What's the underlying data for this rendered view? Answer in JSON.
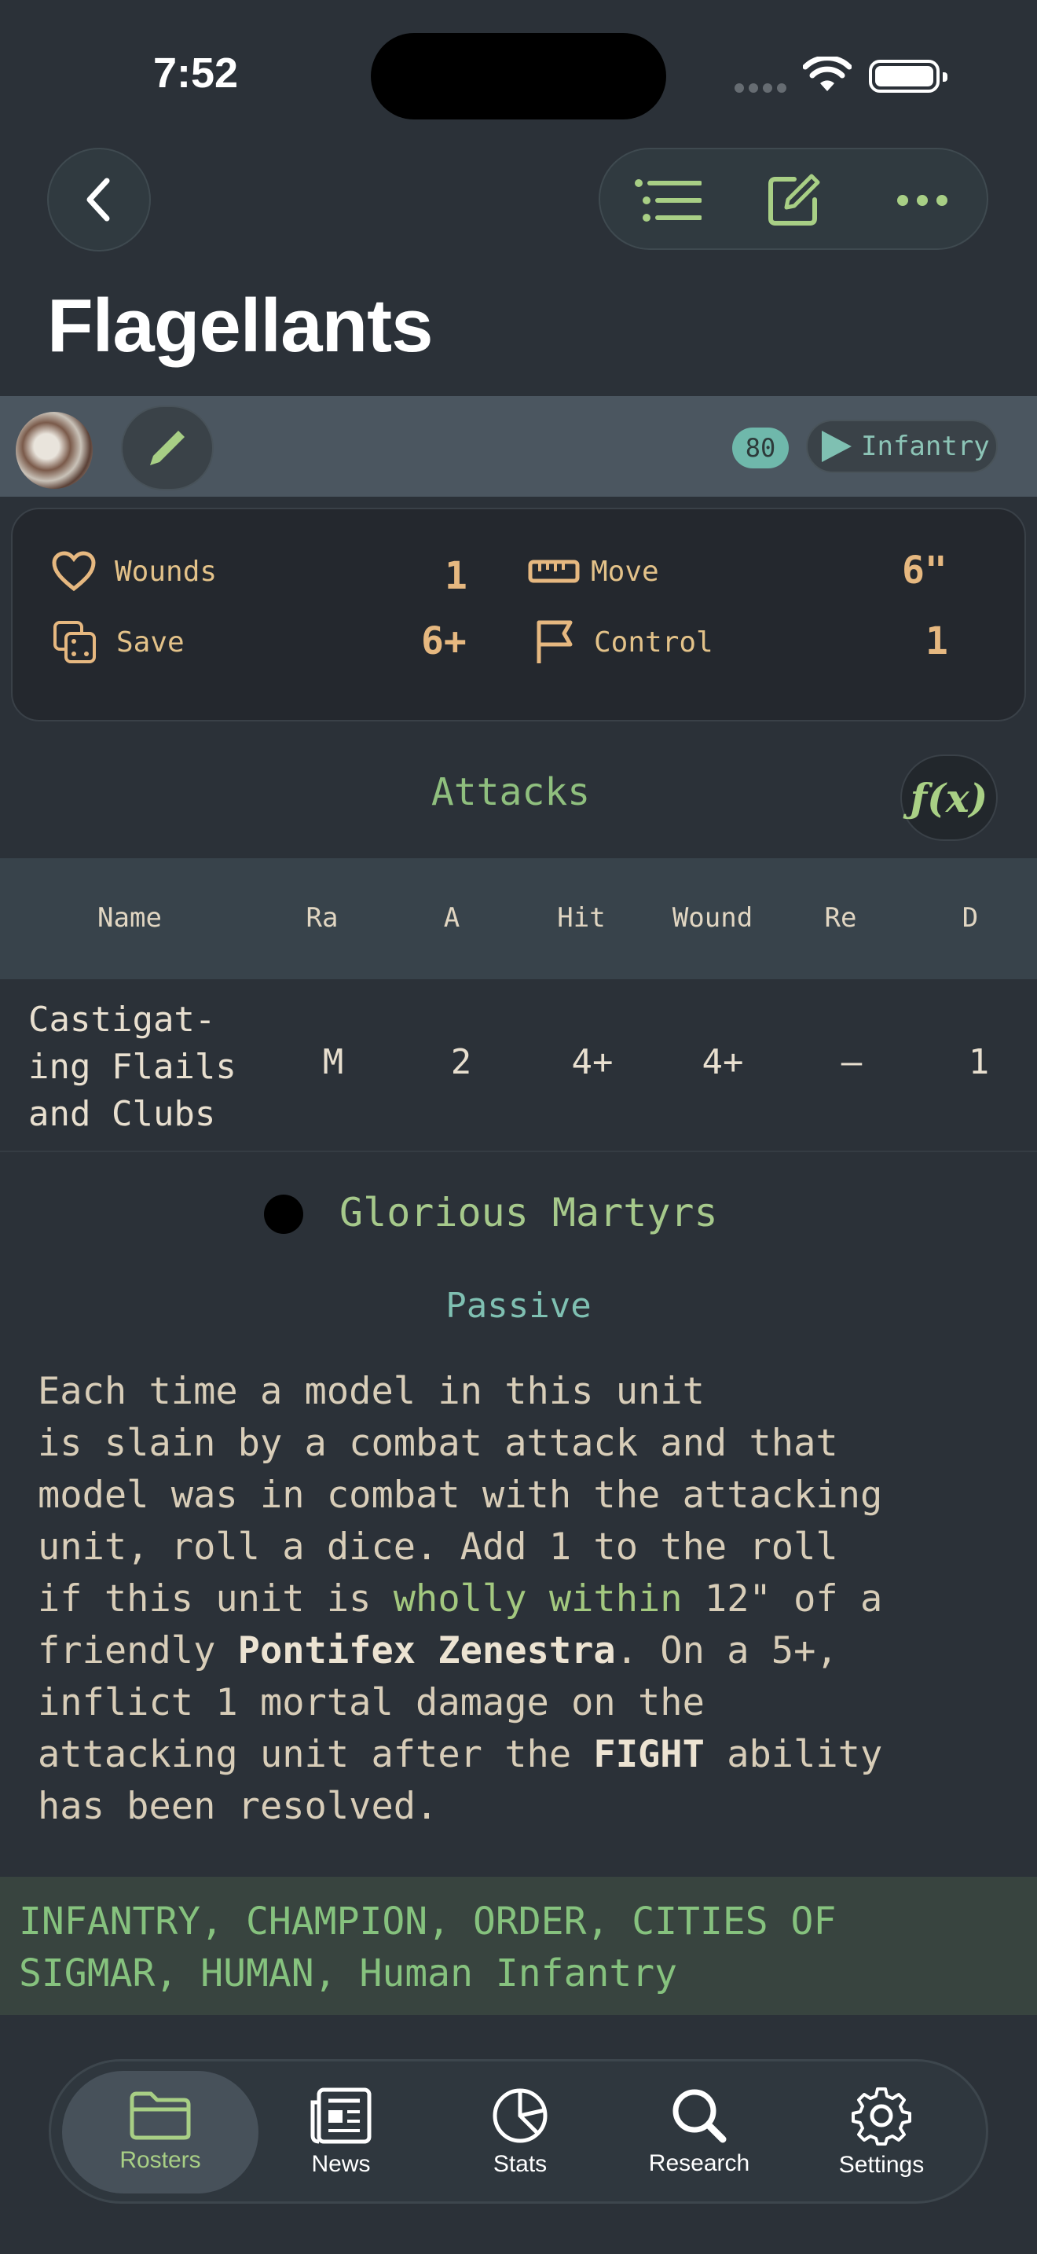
{
  "status_bar": {
    "time": "7:52"
  },
  "nav": {
    "title": "Flagellants"
  },
  "unit": {
    "points": "80",
    "type": "Infantry"
  },
  "stats": [
    {
      "label": "Wounds",
      "value": "1",
      "icon": "heart-icon"
    },
    {
      "label": "Move",
      "value": "6\"",
      "icon": "ruler-icon"
    },
    {
      "label": "Save",
      "value": "6+",
      "icon": "dice-icon"
    },
    {
      "label": "Control",
      "value": "1",
      "icon": "flag-icon"
    }
  ],
  "attacks": {
    "title": "Attacks",
    "fx_label": "ƒ(x)",
    "columns": [
      "Name",
      "Ra",
      "A",
      "Hit",
      "Wound",
      "Re",
      "D"
    ],
    "rows": [
      {
        "name": "Castigat-\ning Flails\nand Clubs",
        "range": "M",
        "attacks": "2",
        "hit": "4+",
        "wound": "4+",
        "rend": "–",
        "damage": "1"
      }
    ]
  },
  "ability": {
    "name": "Glorious Martyrs",
    "timing": "Passive",
    "text_1": "Each time a model in this unit\nis slain by a combat attack and that\nmodel was in combat with the attacking\nunit, roll a dice. Add 1 to the roll\nif this unit is ",
    "text_hl": "wholly within",
    "text_2": " 12\" of a\nfriendly ",
    "text_b1": "Pontifex Zenestra",
    "text_3": ". On a 5+,\ninflict 1 mortal damage on the\nattacking unit after the ",
    "text_b2": "FIGHT",
    "text_4": " ability\nhas been resolved."
  },
  "keywords": "INFANTRY, CHAMPION, ORDER, CITIES OF\nSIGMAR, HUMAN, Human Infantry",
  "tabs": [
    {
      "label": "Rosters",
      "icon": "folder-icon",
      "active": true
    },
    {
      "label": "News",
      "icon": "newspaper-icon"
    },
    {
      "label": "Stats",
      "icon": "pie-chart-icon"
    },
    {
      "label": "Research",
      "icon": "search-icon"
    },
    {
      "label": "Settings",
      "icon": "gear-icon"
    }
  ],
  "colors": {
    "accent_green": "#a8cf85",
    "stat_gold": "#e6b880",
    "teal": "#7fc0b2"
  }
}
